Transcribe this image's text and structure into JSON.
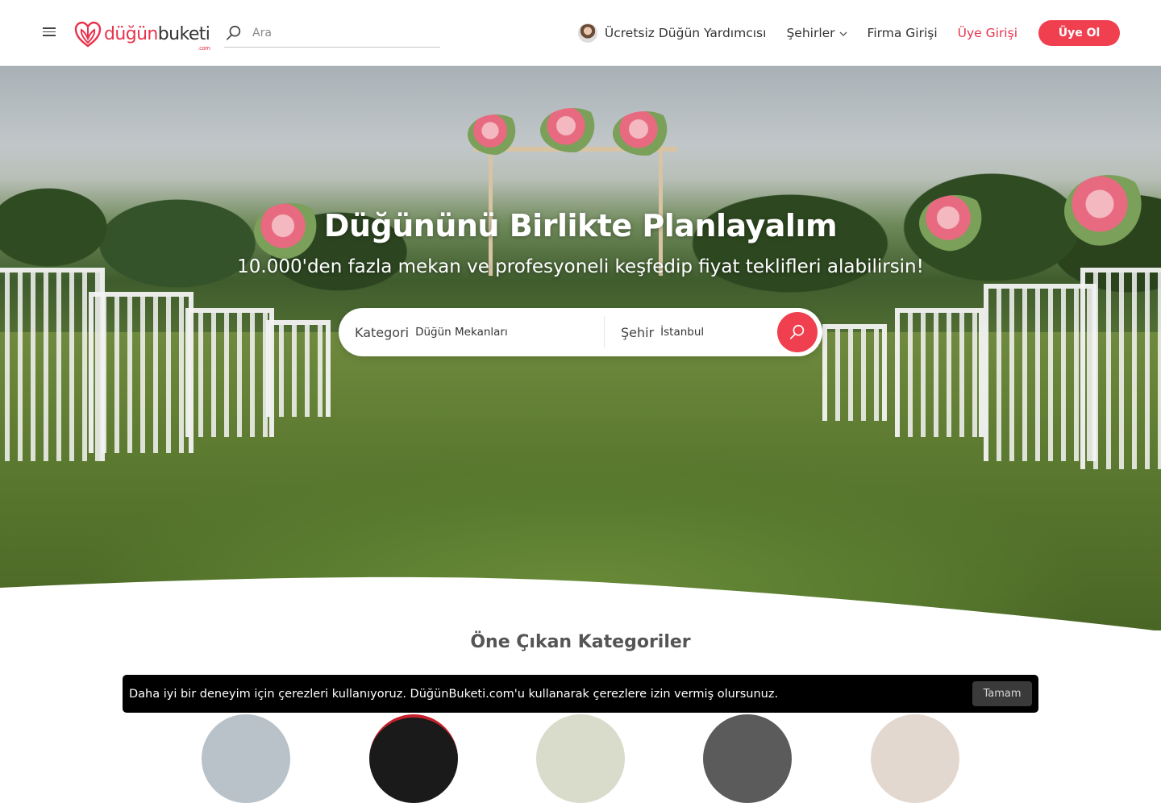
{
  "header": {
    "logo": {
      "part1": "düğün",
      "part2": "buketi",
      "suffix": ".com"
    },
    "search": {
      "placeholder": "Ara"
    },
    "nav": {
      "assistant": "Ücretsiz Düğün Yardımcısı",
      "cities": "Şehirler",
      "vendor_login": "Firma Girişi",
      "member_login": "Üye Girişi",
      "signup": "Üye Ol"
    }
  },
  "hero": {
    "title": "Düğününü Birlikte Planlayalım",
    "subtitle": "10.000'den fazla mekan ve profesyoneli keşfedip fiyat teklifleri alabilirsin!",
    "search": {
      "category_label": "Kategori",
      "category_value": "Düğün Mekanları",
      "city_label": "Şehir",
      "city_value": "İstanbul"
    }
  },
  "featured": {
    "title": "Öne Çıkan Kategoriler"
  },
  "cookie": {
    "text": "Daha iyi bir deneyim için çerezleri kullanıyoruz. DüğünBuketi.com'u kullanarak çerezlere izin vermiş olursunuz.",
    "button": "Tamam"
  },
  "colors": {
    "accent": "#f0404f",
    "brand_red": "#e8334d",
    "cookie_bg": "#000000"
  },
  "icons": {
    "menu": "hamburger-icon",
    "logo": "heart-logo-icon",
    "search": "search-icon",
    "cities_dropdown": "chevron-down-icon"
  }
}
